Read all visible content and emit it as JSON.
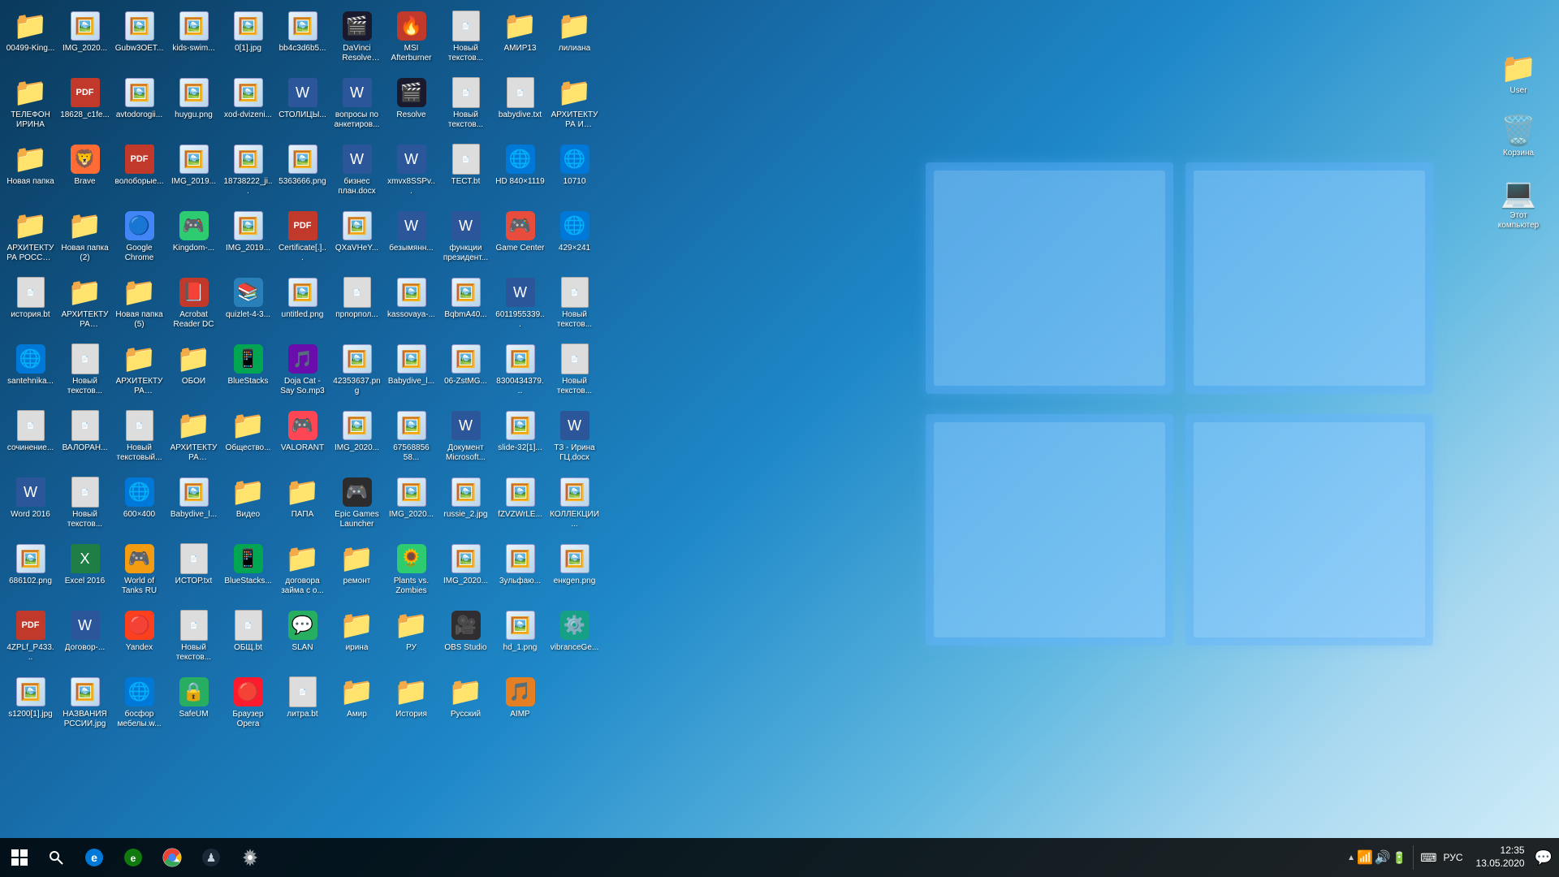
{
  "desktop": {
    "icons": [
      {
        "id": "r1c1",
        "label": "00499-King...",
        "type": "folder",
        "emoji": "📁"
      },
      {
        "id": "r1c2",
        "label": "IMG_2020...",
        "type": "img",
        "emoji": "🖼️"
      },
      {
        "id": "r1c3",
        "label": "Gubw3OET...",
        "type": "img",
        "emoji": "🖼️"
      },
      {
        "id": "r1c4",
        "label": "kids-swim...",
        "type": "img",
        "emoji": "🖼️"
      },
      {
        "id": "r1c5",
        "label": "0[1].jpg",
        "type": "img",
        "emoji": "🖼️"
      },
      {
        "id": "r1c6",
        "label": "bb4c3d6b5...",
        "type": "img",
        "emoji": "🖼️"
      },
      {
        "id": "r1c7",
        "label": "DaVinci Resolve Pro...",
        "type": "app",
        "color": "#1a1a2e",
        "emoji": "🎬"
      },
      {
        "id": "r1c8",
        "label": "MSI Afterburner",
        "type": "app",
        "color": "#c0392b",
        "emoji": "🔥"
      },
      {
        "id": "r1c9",
        "label": "Новый текстов...",
        "type": "txt",
        "emoji": "📄"
      },
      {
        "id": "r1c10",
        "label": "АМИР13",
        "type": "folder",
        "emoji": "📁"
      },
      {
        "id": "r1c11",
        "label": "лилиана",
        "type": "folder",
        "emoji": "📁"
      },
      {
        "id": "r1c12",
        "label": "ТЕЛЕФОН ИРИНА",
        "type": "folder",
        "emoji": "📁"
      },
      {
        "id": "r2c1",
        "label": "18628_c1fe...",
        "type": "pdf",
        "emoji": ""
      },
      {
        "id": "r2c2",
        "label": "avtodorogii...",
        "type": "img",
        "emoji": "🖼️"
      },
      {
        "id": "r2c3",
        "label": "huygu.png",
        "type": "img",
        "emoji": "🖼️"
      },
      {
        "id": "r2c4",
        "label": "xod-dvizeni...",
        "type": "img",
        "emoji": "🖼️"
      },
      {
        "id": "r2c5",
        "label": "СТОЛИЦЫ...",
        "type": "word",
        "emoji": ""
      },
      {
        "id": "r2c6",
        "label": "вопросы по анкетиров...",
        "type": "word",
        "emoji": ""
      },
      {
        "id": "r2c7",
        "label": "Resolve",
        "type": "app",
        "color": "#1a1a2e",
        "emoji": "🎬"
      },
      {
        "id": "r2c8",
        "label": "Новый текстов...",
        "type": "txt",
        "emoji": "📄"
      },
      {
        "id": "r2c9",
        "label": "babydive.txt",
        "type": "txt",
        "emoji": "📄"
      },
      {
        "id": "r2c10",
        "label": "АРХИТЕКТУРА И СКУЛЬП...",
        "type": "folder",
        "emoji": "📁"
      },
      {
        "id": "r2c11",
        "label": "Новая папка",
        "type": "folder",
        "emoji": "📁"
      },
      {
        "id": "r2c12",
        "label": "Brave",
        "type": "app",
        "color": "#ff6b35",
        "emoji": "🦁"
      },
      {
        "id": "r3c1",
        "label": "волоборые...",
        "type": "pdf",
        "emoji": ""
      },
      {
        "id": "r3c2",
        "label": "IMG_2019...",
        "type": "img",
        "emoji": "🖼️"
      },
      {
        "id": "r3c3",
        "label": "18738222_ji...",
        "type": "img",
        "emoji": "🖼️"
      },
      {
        "id": "r3c4",
        "label": "5363666.png",
        "type": "img",
        "emoji": "🖼️"
      },
      {
        "id": "r3c5",
        "label": "бизнес план.docx",
        "type": "word",
        "emoji": ""
      },
      {
        "id": "r3c6",
        "label": "xmvx8SSPv...",
        "type": "word",
        "emoji": ""
      },
      {
        "id": "r3c7",
        "label": "ТЕСТ.bt",
        "type": "txt",
        "emoji": "📄"
      },
      {
        "id": "r3c8",
        "label": "HD 840×1119",
        "type": "app",
        "color": "#0078d7",
        "emoji": "🌐"
      },
      {
        "id": "r3c9",
        "label": "10710",
        "type": "app",
        "color": "#0078d7",
        "emoji": "🌐"
      },
      {
        "id": "r3c10",
        "label": "АРХИТЕКТУРА РОССИЯ И...",
        "type": "folder",
        "emoji": "📁"
      },
      {
        "id": "r3c11",
        "label": "Новая папка (2)",
        "type": "folder",
        "emoji": "📁"
      },
      {
        "id": "r3c12",
        "label": "Google Chrome",
        "type": "app",
        "color": "#4285f4",
        "emoji": "🔵"
      },
      {
        "id": "r4c1",
        "label": "Kingdom-...",
        "type": "app",
        "color": "#2ecc71",
        "emoji": "🎮"
      },
      {
        "id": "r4c2",
        "label": "IMG_2019...",
        "type": "img",
        "emoji": "🖼️"
      },
      {
        "id": "r4c3",
        "label": "Certificate[.]...",
        "type": "pdf",
        "emoji": ""
      },
      {
        "id": "r4c4",
        "label": "QXaVHeY...",
        "type": "img",
        "emoji": "🖼️"
      },
      {
        "id": "r4c5",
        "label": "безымянн...",
        "type": "word",
        "emoji": ""
      },
      {
        "id": "r4c6",
        "label": "функции президент...",
        "type": "word",
        "emoji": ""
      },
      {
        "id": "r4c7",
        "label": "Game Center",
        "type": "app",
        "color": "#e74c3c",
        "emoji": "🎮"
      },
      {
        "id": "r4c8",
        "label": "429×241",
        "type": "app",
        "color": "#0078d7",
        "emoji": "🌐"
      },
      {
        "id": "r4c9",
        "label": "история.bt",
        "type": "txt",
        "emoji": "📄"
      },
      {
        "id": "r4c10",
        "label": "АРХИТЕКТУРА ВЛАДИМИР",
        "type": "folder",
        "emoji": "📁"
      },
      {
        "id": "r4c11",
        "label": "Новая папка (5)",
        "type": "folder",
        "emoji": "📁"
      },
      {
        "id": "r4c12",
        "label": "Acrobat Reader DC",
        "type": "app",
        "color": "#c0392b",
        "emoji": "📕"
      },
      {
        "id": "r5c1",
        "label": "quizlet-4-3...",
        "type": "app",
        "color": "#2980b9",
        "emoji": "📚"
      },
      {
        "id": "r5c2",
        "label": "untitled.png",
        "type": "img",
        "emoji": "🖼️"
      },
      {
        "id": "r5c3",
        "label": "прпорпол...",
        "type": "txt",
        "emoji": "📄"
      },
      {
        "id": "r5c4",
        "label": "kassovaya-...",
        "type": "img",
        "emoji": "🖼️"
      },
      {
        "id": "r5c5",
        "label": "BqbmA40...",
        "type": "img",
        "emoji": "🖼️"
      },
      {
        "id": "r5c6",
        "label": "6011955339...",
        "type": "word",
        "emoji": ""
      },
      {
        "id": "r5c7",
        "label": "Новый текстов...",
        "type": "txt",
        "emoji": "📄"
      },
      {
        "id": "r5c8",
        "label": "santehnika...",
        "type": "app",
        "color": "#0078d7",
        "emoji": "🌐"
      },
      {
        "id": "r5c9",
        "label": "Новый текстов...",
        "type": "txt",
        "emoji": "📄"
      },
      {
        "id": "r5c10",
        "label": "АРХИТЕКТУРА НОВГОРОД",
        "type": "folder",
        "emoji": "📁"
      },
      {
        "id": "r5c11",
        "label": "ОБОИ",
        "type": "folder",
        "emoji": "📁"
      },
      {
        "id": "r5c12",
        "label": "BlueStacks",
        "type": "app",
        "color": "#00a651",
        "emoji": "📱"
      },
      {
        "id": "r6c1",
        "label": "Doja Cat - Say So.mp3",
        "type": "mp3",
        "emoji": ""
      },
      {
        "id": "r6c2",
        "label": "42353637.png",
        "type": "img",
        "emoji": "🖼️"
      },
      {
        "id": "r6c3",
        "label": "Babydive_l...",
        "type": "img",
        "emoji": "🖼️"
      },
      {
        "id": "r6c4",
        "label": "06-ZstMG...",
        "type": "img",
        "emoji": "🖼️"
      },
      {
        "id": "r6c5",
        "label": "8300434379...",
        "type": "img",
        "emoji": "🖼️"
      },
      {
        "id": "r6c6",
        "label": "Новый текстов...",
        "type": "txt",
        "emoji": "📄"
      },
      {
        "id": "r6c7",
        "label": "сочинение...",
        "type": "txt",
        "emoji": "📄"
      },
      {
        "id": "r6c8",
        "label": "ВАЛОРАН...",
        "type": "txt",
        "emoji": "📄"
      },
      {
        "id": "r6c9",
        "label": "Новый текстовый...",
        "type": "txt",
        "emoji": "📄"
      },
      {
        "id": "r6c10",
        "label": "АРХИТЕКТУРА СКУЛЬПТУ...",
        "type": "folder",
        "emoji": "📁"
      },
      {
        "id": "r6c11",
        "label": "Общество...",
        "type": "folder",
        "emoji": "📁"
      },
      {
        "id": "r6c12",
        "label": "VALORANT",
        "type": "app",
        "color": "#ff4655",
        "emoji": "🎮"
      },
      {
        "id": "r7c1",
        "label": "IMG_2020...",
        "type": "img",
        "emoji": "🖼️"
      },
      {
        "id": "r7c2",
        "label": "67568856 58...",
        "type": "img",
        "emoji": "🖼️"
      },
      {
        "id": "r7c3",
        "label": "Документ Microsoft...",
        "type": "word",
        "emoji": ""
      },
      {
        "id": "r7c4",
        "label": "slide-32[1]...",
        "type": "img",
        "emoji": "🖼️"
      },
      {
        "id": "r7c5",
        "label": "ТЗ - Ирина ГЦ.docx",
        "type": "word",
        "emoji": ""
      },
      {
        "id": "r7c6",
        "label": "Word 2016",
        "type": "word",
        "emoji": ""
      },
      {
        "id": "r7c7",
        "label": "Новый текстов...",
        "type": "txt",
        "emoji": "📄"
      },
      {
        "id": "r7c8",
        "label": "600×400",
        "type": "app",
        "color": "#0078d7",
        "emoji": "🌐"
      },
      {
        "id": "r7c9",
        "label": "Babydive_l...",
        "type": "img",
        "emoji": "🖼️"
      },
      {
        "id": "r7c10",
        "label": "Видео",
        "type": "folder",
        "emoji": "📁"
      },
      {
        "id": "r7c11",
        "label": "ПАПА",
        "type": "folder",
        "emoji": "📁"
      },
      {
        "id": "r7c12",
        "label": "Epic Games Launcher",
        "type": "app",
        "color": "#2c2c2c",
        "emoji": "🎮"
      },
      {
        "id": "r8c1",
        "label": "IMG_2020...",
        "type": "img",
        "emoji": "🖼️"
      },
      {
        "id": "r8c2",
        "label": "russie_2.jpg",
        "type": "img",
        "emoji": "🖼️"
      },
      {
        "id": "r8c3",
        "label": "fZVZWrLE...",
        "type": "img",
        "emoji": "🖼️"
      },
      {
        "id": "r8c4",
        "label": "КОЛЛЕКЦИИ...",
        "type": "img",
        "emoji": "🖼️"
      },
      {
        "id": "r8c5",
        "label": "686102.png",
        "type": "img",
        "emoji": "🖼️"
      },
      {
        "id": "r8c6",
        "label": "Excel 2016",
        "type": "excel",
        "emoji": ""
      },
      {
        "id": "r8c7",
        "label": "World of Tanks RU",
        "type": "app",
        "color": "#f39c12",
        "emoji": "🎮"
      },
      {
        "id": "r8c8",
        "label": "ИСТОР.txt",
        "type": "txt",
        "emoji": "📄"
      },
      {
        "id": "r8c9",
        "label": "BlueStacks...",
        "type": "app",
        "color": "#00a651",
        "emoji": "📱"
      },
      {
        "id": "r8c10",
        "label": "договора займа с о...",
        "type": "folder",
        "emoji": "📁"
      },
      {
        "id": "r8c11",
        "label": "ремонт",
        "type": "folder",
        "emoji": "📁"
      },
      {
        "id": "r8c12",
        "label": "Plants vs. Zombies",
        "type": "app",
        "color": "#2ecc71",
        "emoji": "🌻"
      },
      {
        "id": "r9c1",
        "label": "IMG_2020...",
        "type": "img",
        "emoji": "🖼️"
      },
      {
        "id": "r9c2",
        "label": "3ульфаю...",
        "type": "img",
        "emoji": "🖼️"
      },
      {
        "id": "r9c3",
        "label": "енкgen.png",
        "type": "img",
        "emoji": "🖼️"
      },
      {
        "id": "r9c4",
        "label": "4ZPLf_P433...",
        "type": "pdf",
        "emoji": ""
      },
      {
        "id": "r9c5",
        "label": "Договор-...",
        "type": "word",
        "emoji": ""
      },
      {
        "id": "r9c6",
        "label": "Yandex",
        "type": "app",
        "color": "#fc3f1d",
        "emoji": "🔴"
      },
      {
        "id": "r9c7",
        "label": "Новый текстов...",
        "type": "txt",
        "emoji": "📄"
      },
      {
        "id": "r9c8",
        "label": "ОБЩ.bt",
        "type": "txt",
        "emoji": "📄"
      },
      {
        "id": "r9c9",
        "label": "SLAN",
        "type": "app",
        "color": "#27ae60",
        "emoji": "💬"
      },
      {
        "id": "r9c10",
        "label": "ирина",
        "type": "folder",
        "emoji": "📁"
      },
      {
        "id": "r9c11",
        "label": "РУ",
        "type": "folder",
        "emoji": "📁"
      },
      {
        "id": "r9c12",
        "label": "OBS Studio",
        "type": "app",
        "color": "#302e31",
        "emoji": "🎥"
      },
      {
        "id": "r10c1",
        "label": "hd_1.png",
        "type": "img",
        "emoji": "🖼️"
      },
      {
        "id": "r10c2",
        "label": "vibranceGe...",
        "type": "app",
        "color": "#16a085",
        "emoji": "⚙️"
      },
      {
        "id": "r10c3",
        "label": "s1200[1].jpg",
        "type": "img",
        "emoji": "🖼️"
      },
      {
        "id": "r10c4",
        "label": "НАЗВАНИЯ РССИИ.jpg",
        "type": "img",
        "emoji": "🖼️"
      },
      {
        "id": "r10c5",
        "label": "босфор мебелы.w...",
        "type": "app",
        "color": "#0078d7",
        "emoji": "🌐"
      },
      {
        "id": "r10c6",
        "label": "SafeUM",
        "type": "app",
        "color": "#27ae60",
        "emoji": "🔒"
      },
      {
        "id": "r10c7",
        "label": "Браузер Opera",
        "type": "app",
        "color": "#ff1b2d",
        "emoji": "🔴"
      },
      {
        "id": "r10c8",
        "label": "литра.bt",
        "type": "txt",
        "emoji": "📄"
      },
      {
        "id": "r10c9",
        "label": "Амир",
        "type": "folder",
        "emoji": "📁"
      },
      {
        "id": "r10c10",
        "label": "История",
        "type": "folder",
        "emoji": "📁"
      },
      {
        "id": "r10c11",
        "label": "Русский",
        "type": "folder",
        "emoji": "📁"
      },
      {
        "id": "r10c12",
        "label": "AIMP",
        "type": "app",
        "color": "#e67e22",
        "emoji": "🎵"
      }
    ],
    "right_icons": [
      {
        "label": "User",
        "type": "folder_user",
        "emoji": "👤"
      },
      {
        "label": "Корзина",
        "type": "recycle",
        "emoji": "🗑️"
      },
      {
        "label": "Этот компьютер",
        "type": "computer",
        "emoji": "💻"
      }
    ]
  },
  "taskbar": {
    "start_label": "⊞",
    "search_icon": "🔍",
    "pinned": [
      {
        "label": "Edge",
        "emoji": "🌐",
        "color": "#0078d7"
      },
      {
        "label": "Edge2",
        "emoji": "🌐",
        "color": "#0078d7"
      },
      {
        "label": "Chrome",
        "emoji": "🔵",
        "color": "#4285f4"
      },
      {
        "label": "Steam",
        "emoji": "🎮",
        "color": "#1b2838"
      },
      {
        "label": "Settings",
        "emoji": "⚙️",
        "color": "#555"
      }
    ],
    "systray_icons": [
      "🔼",
      "📶",
      "🔊",
      "🖥",
      "⌨"
    ],
    "language": "РУС",
    "time": "12:35",
    "date": "13.05.2020"
  }
}
